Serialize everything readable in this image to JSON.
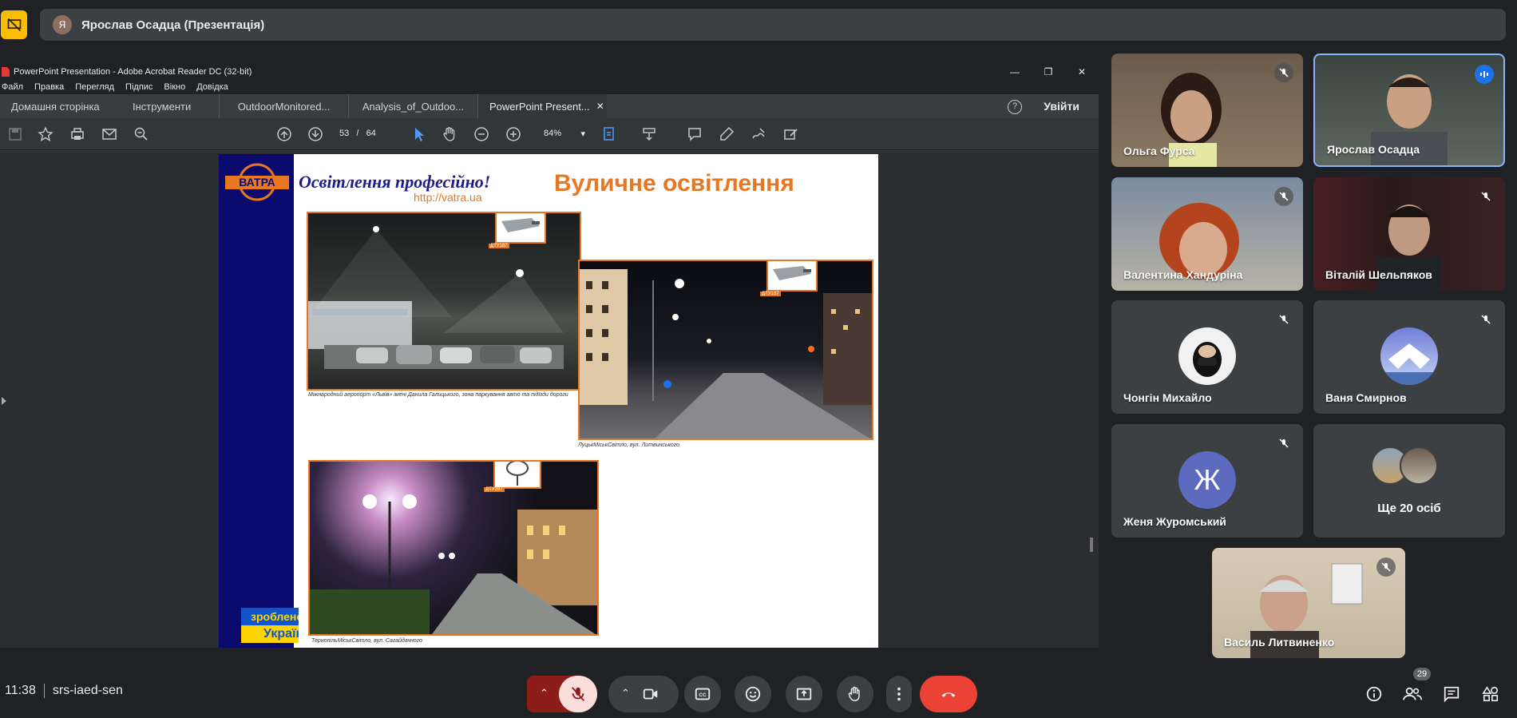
{
  "presentation_bar": {
    "avatar_initial": "Я",
    "title": "Ярослав Осадца (Презентація)"
  },
  "acrobat": {
    "window_title": "PowerPoint Presentation - Adobe Acrobat Reader DC (32-bit)",
    "menu": [
      "Файл",
      "Правка",
      "Перегляд",
      "Підпис",
      "Вікно",
      "Довідка"
    ],
    "tabs": {
      "home": "Домашня сторінка",
      "tools": "Інструменти",
      "doc1": "OutdoorMonitored...",
      "doc2": "Analysis_of_Outdoo...",
      "doc3": "PowerPoint Present..."
    },
    "help": "?",
    "sign_in": "Увійти",
    "page_current": "53",
    "page_sep": "/",
    "page_total": "64",
    "zoom": "84%"
  },
  "slide": {
    "brand": "ВАТРА",
    "slogan": "Освітлення професійно!",
    "url": "http://vatra.ua",
    "title": "Вуличне освітлення",
    "photo1_label": "ДТУ187",
    "photo1_caption": "Міжнародний аеропорт «Львів» імені Данила Галицького, зона паркування авто та підїзди дороги",
    "photo2_label": "ДТУ187",
    "photo2_caption": "ЛуцькМіськСвітло, вул. Литвинського",
    "photo3_label": "ДТУ287",
    "photo3_caption": "ТернопільМіськСвітло, вул. Сагайдачного",
    "badge_top": "зроблено",
    "badge_bottom": "Україн"
  },
  "participants": [
    {
      "name": "Ольга Фурса",
      "state": "muted"
    },
    {
      "name": "Ярослав Осадца",
      "state": "speaking"
    },
    {
      "name": "Валентина Хандуріна",
      "state": "muted"
    },
    {
      "name": "Віталій Шельпяков",
      "state": "muted"
    },
    {
      "name": "Чонгін Михайло",
      "state": "muted"
    },
    {
      "name": "Ваня Смирнов",
      "state": "muted"
    },
    {
      "name": "Женя Журомський",
      "initial": "Ж",
      "state": "muted"
    },
    {
      "name": "Василь Литвиненко",
      "state": "muted"
    }
  ],
  "more_people": "Ще 20 осіб",
  "bottom": {
    "time": "11:38",
    "meeting_code": "srs-iaed-sen",
    "people_count": "29"
  },
  "colors": {
    "accent_orange": "#e87722",
    "end_call_red": "#ea4335",
    "present_yellow": "#fbbc04",
    "speaking_blue": "#1a73e8",
    "avatar_zh": "#5c6bc0"
  }
}
